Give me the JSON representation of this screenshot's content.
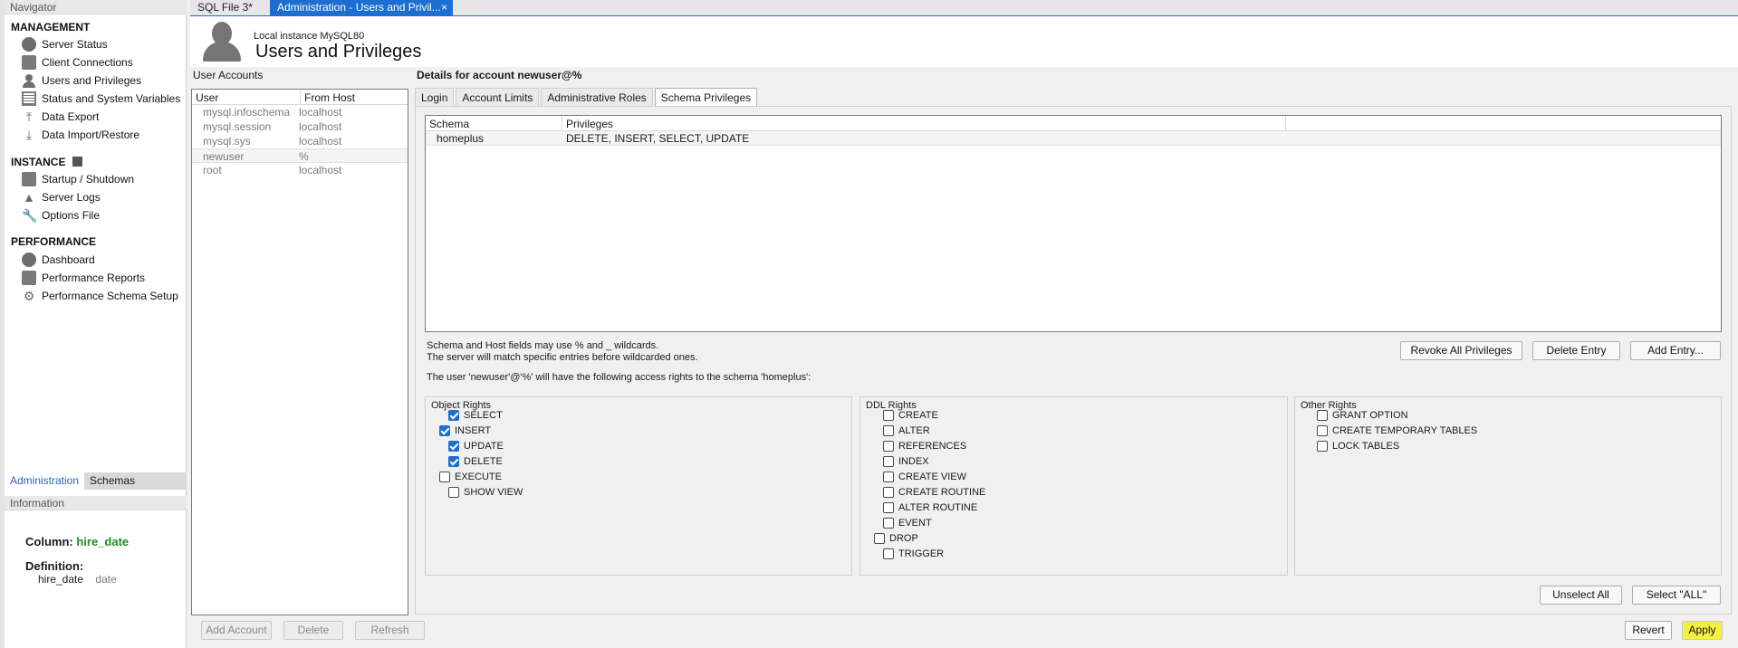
{
  "navigator": {
    "title": "Navigator",
    "management": {
      "title": "MANAGEMENT",
      "items": [
        "Server Status",
        "Client Connections",
        "Users and Privileges",
        "Status and System Variables",
        "Data Export",
        "Data Import/Restore"
      ]
    },
    "instance": {
      "title": "INSTANCE",
      "items": [
        "Startup / Shutdown",
        "Server Logs",
        "Options File"
      ]
    },
    "performance": {
      "title": "PERFORMANCE",
      "items": [
        "Dashboard",
        "Performance Reports",
        "Performance Schema Setup"
      ]
    },
    "tabs": [
      "Administration",
      "Schemas"
    ],
    "information": {
      "title": "Information",
      "column_label": "Column:",
      "column_value": "hire_date",
      "definition_label": "Definition:",
      "def_name": "hire_date",
      "def_type": "date"
    }
  },
  "top_tabs": {
    "tab1": "SQL File 3*",
    "tab2": "Administration - Users and Privil...",
    "close": "×"
  },
  "header": {
    "instance": "Local instance MySQL80",
    "title": "Users and Privileges"
  },
  "user_accounts": {
    "title": "User Accounts",
    "columns": [
      "User",
      "From Host"
    ],
    "rows": [
      {
        "user": "mysql.infoschema",
        "host": "localhost"
      },
      {
        "user": "mysql.session",
        "host": "localhost"
      },
      {
        "user": "mysql.sys",
        "host": "localhost"
      },
      {
        "user": "newuser",
        "host": "%"
      },
      {
        "user": "root",
        "host": "localhost"
      }
    ],
    "buttons": {
      "add": "Add Account",
      "delete": "Delete",
      "refresh": "Refresh"
    }
  },
  "details": {
    "title": "Details for account newuser@%",
    "tabs": [
      "Login",
      "Account Limits",
      "Administrative Roles",
      "Schema Privileges"
    ],
    "active_tab": "Schema Privileges",
    "schema_columns": [
      "Schema",
      "Privileges"
    ],
    "schema_rows": [
      {
        "schema": "homeplus",
        "privileges": "DELETE, INSERT, SELECT, UPDATE"
      }
    ],
    "note1": "Schema and Host fields may use % and _ wildcards.",
    "note2": "The server will match specific entries before wildcarded ones.",
    "access_note": "The user 'newuser'@'%' will have the following access rights to the schema 'homeplus':",
    "buttons": {
      "revoke": "Revoke All Privileges",
      "delete_entry": "Delete Entry",
      "add_entry": "Add Entry...",
      "unselect_all": "Unselect All",
      "select_all": "Select \"ALL\"",
      "revert": "Revert",
      "apply": "Apply"
    },
    "object_rights": {
      "title": "Object Rights",
      "items": [
        {
          "label": "SELECT",
          "checked": true
        },
        {
          "label": "INSERT",
          "checked": true
        },
        {
          "label": "UPDATE",
          "checked": true
        },
        {
          "label": "DELETE",
          "checked": true
        },
        {
          "label": "EXECUTE",
          "checked": false
        },
        {
          "label": "SHOW VIEW",
          "checked": false
        }
      ]
    },
    "ddl_rights": {
      "title": "DDL Rights",
      "items": [
        {
          "label": "CREATE",
          "checked": false
        },
        {
          "label": "ALTER",
          "checked": false
        },
        {
          "label": "REFERENCES",
          "checked": false
        },
        {
          "label": "INDEX",
          "checked": false
        },
        {
          "label": "CREATE VIEW",
          "checked": false
        },
        {
          "label": "CREATE ROUTINE",
          "checked": false
        },
        {
          "label": "ALTER ROUTINE",
          "checked": false
        },
        {
          "label": "EVENT",
          "checked": false
        },
        {
          "label": "DROP",
          "checked": false
        },
        {
          "label": "TRIGGER",
          "checked": false
        }
      ]
    },
    "other_rights": {
      "title": "Other Rights",
      "items": [
        {
          "label": "GRANT OPTION",
          "checked": false
        },
        {
          "label": "CREATE TEMPORARY TABLES",
          "checked": false
        },
        {
          "label": "LOCK TABLES",
          "checked": false
        }
      ]
    }
  },
  "colors": {
    "accent": "#1c6fd0",
    "column_value": "#1f8a1f",
    "apply_highlight": "#f4f042"
  }
}
